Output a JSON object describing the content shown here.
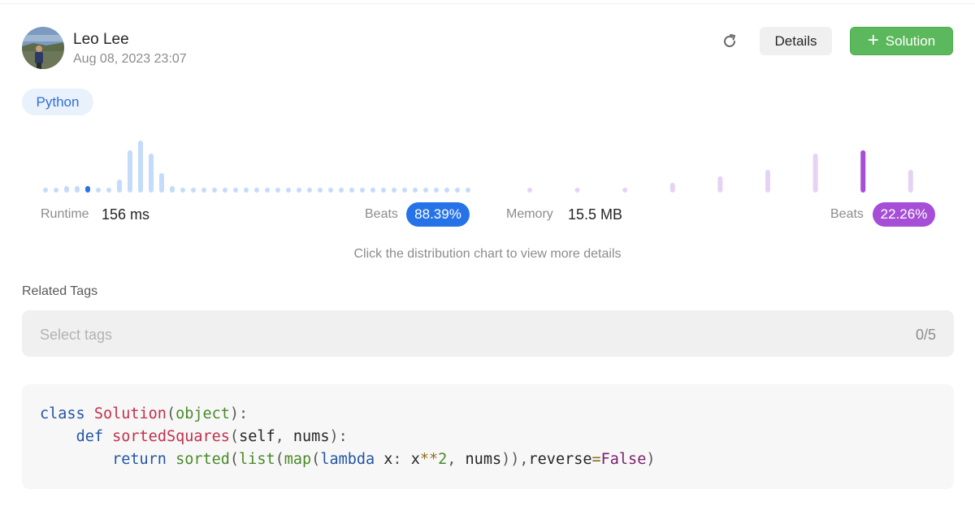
{
  "user": {
    "name": "Leo Lee",
    "timestamp": "Aug 08, 2023 23:07"
  },
  "actions": {
    "refresh_icon": "refresh-icon",
    "details_label": "Details",
    "solution_label": "Solution",
    "solution_icon": "plus-icon"
  },
  "language": "Python",
  "runtime": {
    "label": "Runtime",
    "value": "156 ms",
    "beats_label": "Beats",
    "beats_value": "88.39%",
    "color": "#2673e8",
    "distribution": [
      1,
      1,
      2,
      2,
      2,
      1,
      1,
      4,
      13,
      16,
      12,
      6,
      2,
      1,
      1,
      1,
      1,
      1,
      1,
      1,
      1,
      1,
      1,
      1,
      1,
      1,
      1,
      1,
      1,
      1,
      1,
      1,
      1,
      1,
      1,
      1,
      1,
      1,
      1,
      1,
      1
    ],
    "selected_index": 4
  },
  "memory": {
    "label": "Memory",
    "value": "15.5 MB",
    "beats_label": "Beats",
    "beats_value": "22.26%",
    "color": "#a64fd6",
    "distribution": [
      1,
      1,
      1,
      3,
      5,
      7,
      12,
      13,
      7
    ],
    "selected_index": 7
  },
  "hint": "Click the distribution chart to view more details",
  "tags": {
    "title": "Related Tags",
    "placeholder": "Select tags",
    "count": "0/5"
  },
  "code": {
    "line1": [
      "class",
      "Solution",
      "(",
      "object",
      "):"
    ],
    "line2": [
      "def",
      "sortedSquares",
      "(",
      "self",
      ", ",
      "nums",
      "):"
    ],
    "line3": [
      "return",
      "sorted",
      "(",
      "list",
      "(",
      "map",
      "(",
      "lambda",
      "x",
      ": ",
      "x",
      "**",
      "2",
      ", ",
      "nums",
      ")),",
      "reverse",
      "=",
      "False",
      ")"
    ]
  }
}
